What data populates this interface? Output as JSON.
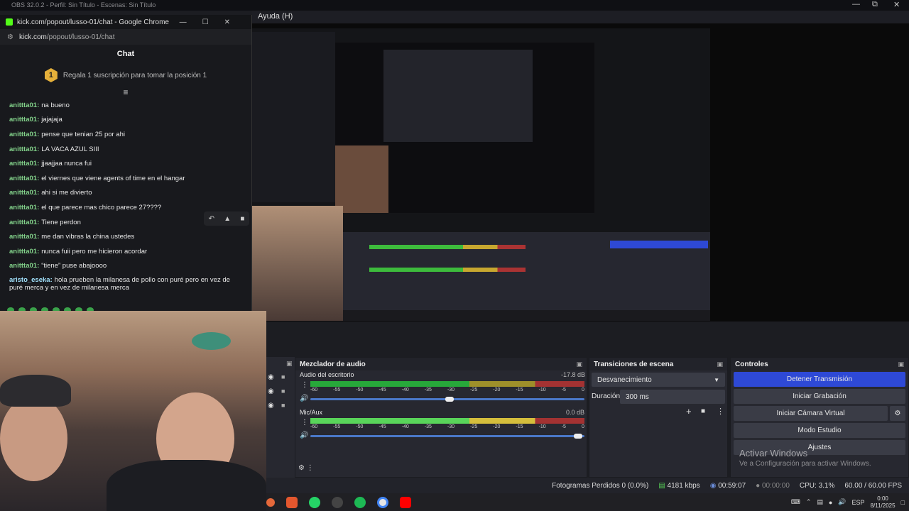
{
  "obs": {
    "title": "OBS 32.0.2 - Perfil: Sin Título - Escenas: Sin Título",
    "menu_visible": "Ayuda (H)"
  },
  "chat_window": {
    "title": "kick.com/popout/lusso-01/chat - Google Chrome",
    "url_host": "kick.com",
    "url_path": "/popout/lusso-01/chat",
    "header": "Chat",
    "gift_rank": "1",
    "gift_text": "Regala 1 suscripción para tomar la posición 1",
    "messages": [
      {
        "user": "anittta01:",
        "text": "na bueno"
      },
      {
        "user": "anittta01:",
        "text": "jajajaja"
      },
      {
        "user": "anittta01:",
        "text": "pense que tenian 25 por ahi"
      },
      {
        "user": "anittta01:",
        "text": "LA VACA AZUL SIII"
      },
      {
        "user": "anittta01:",
        "text": "jjaajjaa nunca fui"
      },
      {
        "user": "anittta01:",
        "text": "el viernes que viene agents of time en el hangar"
      },
      {
        "user": "anittta01:",
        "text": "ahi si me divierto"
      },
      {
        "user": "anittta01:",
        "text": "el que parece mas chico parece 27????"
      },
      {
        "user": "anittta01:",
        "text": "Tiene perdon"
      },
      {
        "user": "anittta01:",
        "text": "me dan vibras la china ustedes"
      },
      {
        "user": "anittta01:",
        "text": "nunca fuii pero me hicieron acordar"
      },
      {
        "user": "anittta01:",
        "text": "“tiene” puse abajoooo"
      },
      {
        "user": "aristo_eseka:",
        "text": "hola prueben la milanesa de pollo con puré pero en vez de puré merca y en vez de milanesa merca"
      }
    ]
  },
  "mixer": {
    "title": "Mezclador de audio",
    "tracks": [
      {
        "name": "Audio del escritorio",
        "db": "-17.8 dB",
        "level": 0.72
      },
      {
        "name": "Mic/Aux",
        "db": "0.0 dB",
        "level": 1.0
      }
    ],
    "scale": [
      "-60",
      "-55",
      "-50",
      "-45",
      "-40",
      "-35",
      "-30",
      "-25",
      "-20",
      "-15",
      "-10",
      "-5",
      "0"
    ]
  },
  "transitions": {
    "title": "Transiciones de escena",
    "selected": "Desvanecimiento",
    "duration_label": "Duración",
    "duration_value": "300 ms"
  },
  "controls": {
    "title": "Controles",
    "stop_stream": "Detener Transmisión",
    "start_record": "Iniciar Grabación",
    "virtual_cam": "Iniciar Cámara Virtual",
    "studio_mode": "Modo Estudio",
    "settings": "Ajustes"
  },
  "watermark": {
    "line1": "Activar Windows",
    "line2": "Ve a Configuración para activar Windows."
  },
  "status": {
    "dropped": "Fotogramas Perdidos 0 (0.0%)",
    "bitrate": "4181 kbps",
    "stream_time": "00:59:07",
    "rec_time": "00:00:00",
    "cpu": "CPU: 3.1%",
    "fps": "60.00 / 60.00 FPS"
  },
  "tray": {
    "lang": "ESP",
    "time": "0:00",
    "date": "8/11/2025"
  },
  "colors": {
    "accent": "#2e49d6",
    "kick_green": "#53fc18",
    "username": "#83d38b"
  }
}
